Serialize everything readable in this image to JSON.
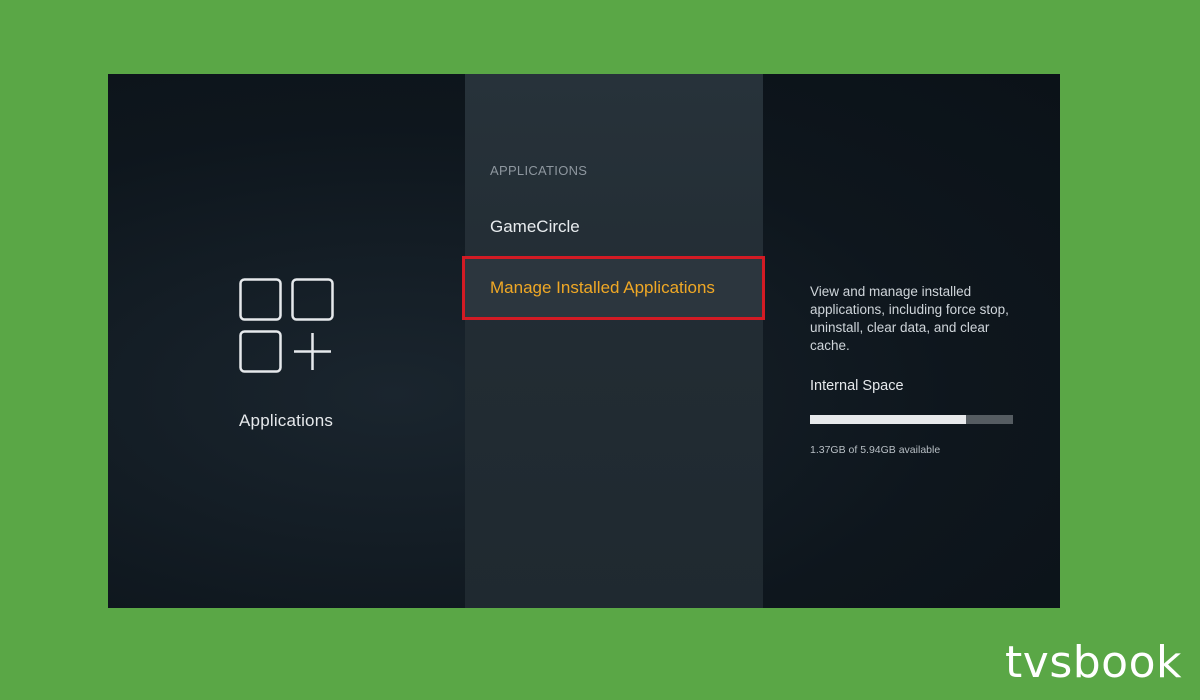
{
  "left_pane": {
    "icon": "apps-grid-plus-icon",
    "title": "Applications"
  },
  "middle_pane": {
    "section_heading": "APPLICATIONS",
    "items": [
      {
        "label": "GameCircle",
        "selected": false
      },
      {
        "label": "Manage Installed Applications",
        "selected": true
      }
    ]
  },
  "right_pane": {
    "description": "View and manage installed applications, including force stop, uninstall, clear data, and clear cache.",
    "storage_label": "Internal Space",
    "storage_used_fraction": 0.77,
    "storage_caption": "1.37GB of 5.94GB available"
  },
  "colors": {
    "background": "#5aa746",
    "selected_text": "#f0a825",
    "highlight_border": "#d31b24"
  },
  "watermark": "tvsbook"
}
